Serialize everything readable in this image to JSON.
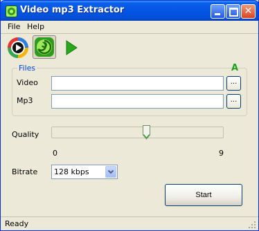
{
  "window": {
    "title": "Video mp3 Extractor"
  },
  "menu": {
    "file": "File",
    "help": "Help"
  },
  "icons": {
    "app": "app-icon",
    "open_video": "play-circle-icon",
    "convert": "swirl-icon",
    "run": "play-arrow-icon"
  },
  "files_group": {
    "legend": "Files",
    "badge": "A",
    "video_label": "Video",
    "video_value": "",
    "mp3_label": "Mp3",
    "mp3_value": "",
    "browse_label": "..."
  },
  "quality": {
    "label": "Quality",
    "min_label": "0",
    "max_label": "9",
    "min": 0,
    "max": 9,
    "value": 5
  },
  "bitrate": {
    "label": "Bitrate",
    "selected": "128 kbps"
  },
  "start_button": "Start",
  "status": "Ready",
  "colors": {
    "titlebar": "#0554e4",
    "group_legend": "#0046d5",
    "badge": "#1fa11f"
  }
}
